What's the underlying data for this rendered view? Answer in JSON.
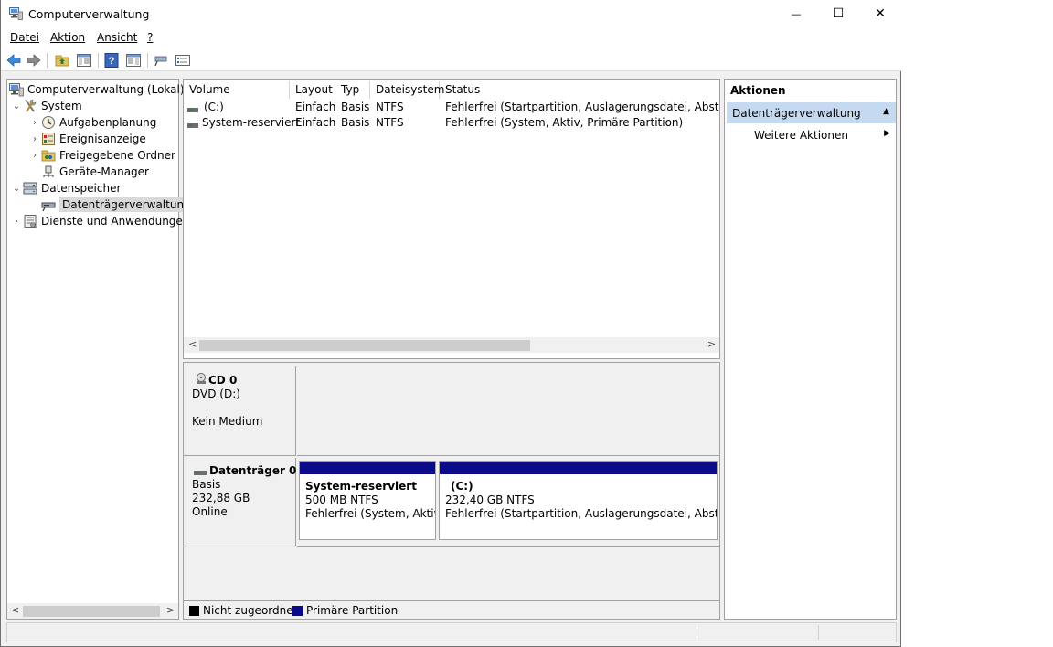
{
  "window": {
    "title": "Computerverwaltung",
    "minimize_glyph": "—",
    "maximize_glyph": "☐",
    "close_glyph": "✕"
  },
  "menu": [
    "Datei",
    "Aktion",
    "Ansicht",
    "?"
  ],
  "tree": {
    "items": [
      {
        "label": "Computerverwaltung (Lokal)",
        "icon": "computer-management-icon",
        "level": 0,
        "expander": ""
      },
      {
        "label": "System",
        "icon": "tools-icon",
        "level": 1,
        "expander": "⌄"
      },
      {
        "label": "Aufgabenplanung",
        "icon": "clock-icon",
        "level": 2,
        "expander": "›"
      },
      {
        "label": "Ereignisanzeige",
        "icon": "event-viewer-icon",
        "level": 2,
        "expander": "›"
      },
      {
        "label": "Freigegebene Ordner",
        "icon": "shared-folder-icon",
        "level": 2,
        "expander": "›"
      },
      {
        "label": "Geräte-Manager",
        "icon": "device-manager-icon",
        "level": 2,
        "expander": ""
      },
      {
        "label": "Datenspeicher",
        "icon": "storage-icon",
        "level": 1,
        "expander": "⌄"
      },
      {
        "label": "Datenträgerverwaltung",
        "icon": "disk-management-icon",
        "level": 2,
        "expander": "",
        "selected": true
      },
      {
        "label": "Dienste und Anwendungen",
        "icon": "services-icon",
        "level": 1,
        "expander": "›"
      }
    ]
  },
  "volumes": {
    "columns": [
      "Volume",
      "Layout",
      "Typ",
      "Dateisystem",
      "Status"
    ],
    "rows": [
      {
        "volume": "(C:)",
        "layout": "Einfach",
        "typ": "Basis",
        "dateisystem": "NTFS",
        "status": "Fehlerfrei (Startpartition, Auslagerungsdatei, Absturzabbil"
      },
      {
        "volume": "System-reserviert",
        "layout": "Einfach",
        "typ": "Basis",
        "dateisystem": "NTFS",
        "status": "Fehlerfrei (System, Aktiv, Primäre Partition)"
      }
    ]
  },
  "disks": {
    "cd": {
      "name": "CD 0",
      "type": "DVD (D:)",
      "media": "Kein Medium"
    },
    "disk0": {
      "name": "Datenträger 0",
      "type": "Basis",
      "size": "232,88 GB",
      "state": "Online",
      "partitions": [
        {
          "name": "System-reserviert",
          "size": "500 MB NTFS",
          "status": "Fehlerfrei (System, Aktiv, P"
        },
        {
          "name": "(C:)",
          "size": "232,40 GB NTFS",
          "status": "Fehlerfrei (Startpartition, Auslagerungsdatei, Absturzabb"
        }
      ]
    }
  },
  "legend": [
    {
      "label": "Nicht zugeordnet",
      "color": "#000000"
    },
    {
      "label": "Primäre Partition",
      "color": "#0a0a8a"
    }
  ],
  "actions": {
    "header": "Aktionen",
    "section": "Datenträgerverwaltung",
    "item": "Weitere Aktionen"
  },
  "colors": {
    "accent_section": "#c5d9f0",
    "partition_bar": "#0a0a8a"
  }
}
